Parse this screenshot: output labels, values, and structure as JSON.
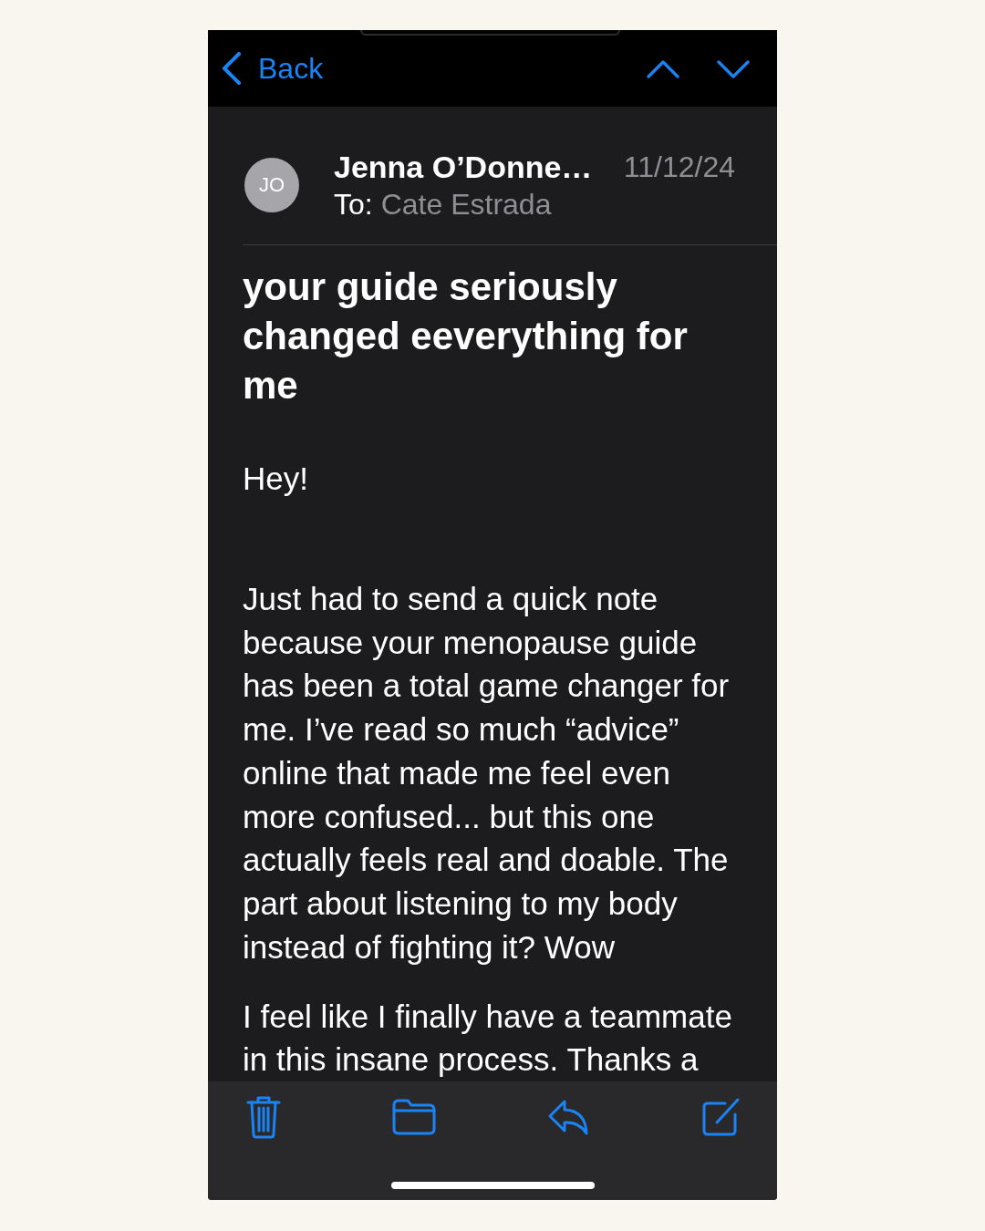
{
  "nav": {
    "back_label": "Back"
  },
  "message": {
    "avatar_initials": "JO",
    "sender": "Jenna O’Donne…",
    "to_label": "To:",
    "recipient": "Cate Estrada",
    "date": "11/12/24",
    "subject": "your guide seriously changed eeverything for me",
    "body": [
      "Hey!",
      "Just had to send a quick note because your menopause guide has been a total game changer for me. I’ve read so much “advice” online that made me feel even more confused... but this one actually feels real and doable. The part about listening to my body instead of fighting it? Wow",
      "I feel like I finally have a teammate in this insane process. Thanks a"
    ]
  }
}
